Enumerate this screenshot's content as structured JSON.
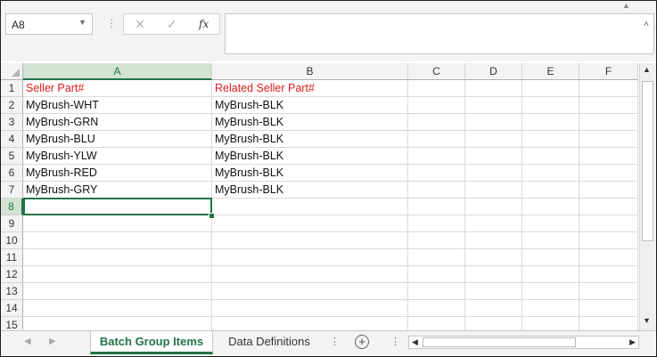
{
  "namebox": {
    "value": "A8",
    "dropdown_icon": "chevron-down-icon"
  },
  "formula_bar": {
    "cancel_icon": "✕",
    "enter_icon": "✓",
    "fx_label": "fx",
    "value": ""
  },
  "columns": [
    "A",
    "B",
    "C",
    "D",
    "E",
    "F"
  ],
  "rows": [
    "1",
    "2",
    "3",
    "4",
    "5",
    "6",
    "7",
    "8",
    "9",
    "10",
    "11",
    "12",
    "13",
    "14",
    "15"
  ],
  "cells": [
    [
      "Seller Part#",
      "Related Seller Part#"
    ],
    [
      "MyBrush-WHT",
      "MyBrush-BLK"
    ],
    [
      "MyBrush-GRN",
      "MyBrush-BLK"
    ],
    [
      "MyBrush-BLU",
      "MyBrush-BLK"
    ],
    [
      "MyBrush-YLW",
      "MyBrush-BLK"
    ],
    [
      "MyBrush-RED",
      "MyBrush-BLK"
    ],
    [
      "MyBrush-GRY",
      "MyBrush-BLK"
    ]
  ],
  "selected_cell": "A8",
  "sheets": [
    {
      "label": "Batch Group Items",
      "active": true
    },
    {
      "label": "Data Definitions",
      "active": false
    }
  ],
  "colors": {
    "accent": "#217346",
    "header_text": "#e01b1b"
  }
}
